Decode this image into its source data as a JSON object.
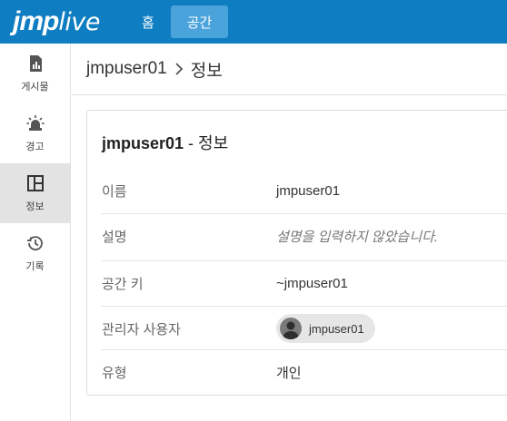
{
  "app": {
    "logo_bold": "jmp",
    "logo_light": "live"
  },
  "nav": {
    "home_label": "홈",
    "space_label": "공간"
  },
  "sidebar": {
    "items": [
      {
        "label": "게시물",
        "icon": "bar-chart-icon"
      },
      {
        "label": "경고",
        "icon": "siren-alert-icon"
      },
      {
        "label": "정보",
        "icon": "layout-panel-icon",
        "active": true
      },
      {
        "label": "기록",
        "icon": "history-icon"
      }
    ]
  },
  "breadcrumb": {
    "root": "jmpuser01",
    "current": "정보"
  },
  "card": {
    "title_user": "jmpuser01",
    "title_suffix": " - 정보",
    "rows": [
      {
        "label": "이름",
        "value": "jmpuser01"
      },
      {
        "label": "설명",
        "value": "설명을 입력하지 않았습니다."
      },
      {
        "label": "공간 키",
        "value": "~jmpuser01"
      },
      {
        "label": "관리자 사용자",
        "value": "jmpuser01"
      },
      {
        "label": "유형",
        "value": "개인"
      }
    ]
  },
  "colors": {
    "header": "#0e7dc2",
    "nav_active": "#4ba3dc",
    "sidebar_active": "#e3e3e3"
  }
}
